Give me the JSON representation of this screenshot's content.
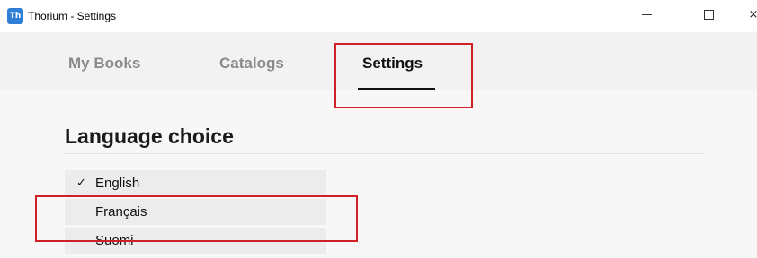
{
  "window": {
    "icon_text": "Th",
    "title": "Thorium - Settings",
    "controls": {
      "minimize_icon": "minimize-icon",
      "maximize_icon": "maximize-icon",
      "close_glyph": "×"
    }
  },
  "tabs": [
    {
      "label": "My Books",
      "active": false
    },
    {
      "label": "Catalogs",
      "active": false
    },
    {
      "label": "Settings",
      "active": true
    }
  ],
  "main": {
    "section_title": "Language choice",
    "languages": [
      {
        "label": "English",
        "selected": true,
        "check": "✓"
      },
      {
        "label": "Français",
        "selected": false
      },
      {
        "label": "Suomi",
        "selected": false
      }
    ]
  },
  "colors": {
    "highlight": "#d11f26",
    "app_icon": "#2f7fd6",
    "active_tab": "#111111",
    "inactive_tab": "#8a8a8a"
  }
}
